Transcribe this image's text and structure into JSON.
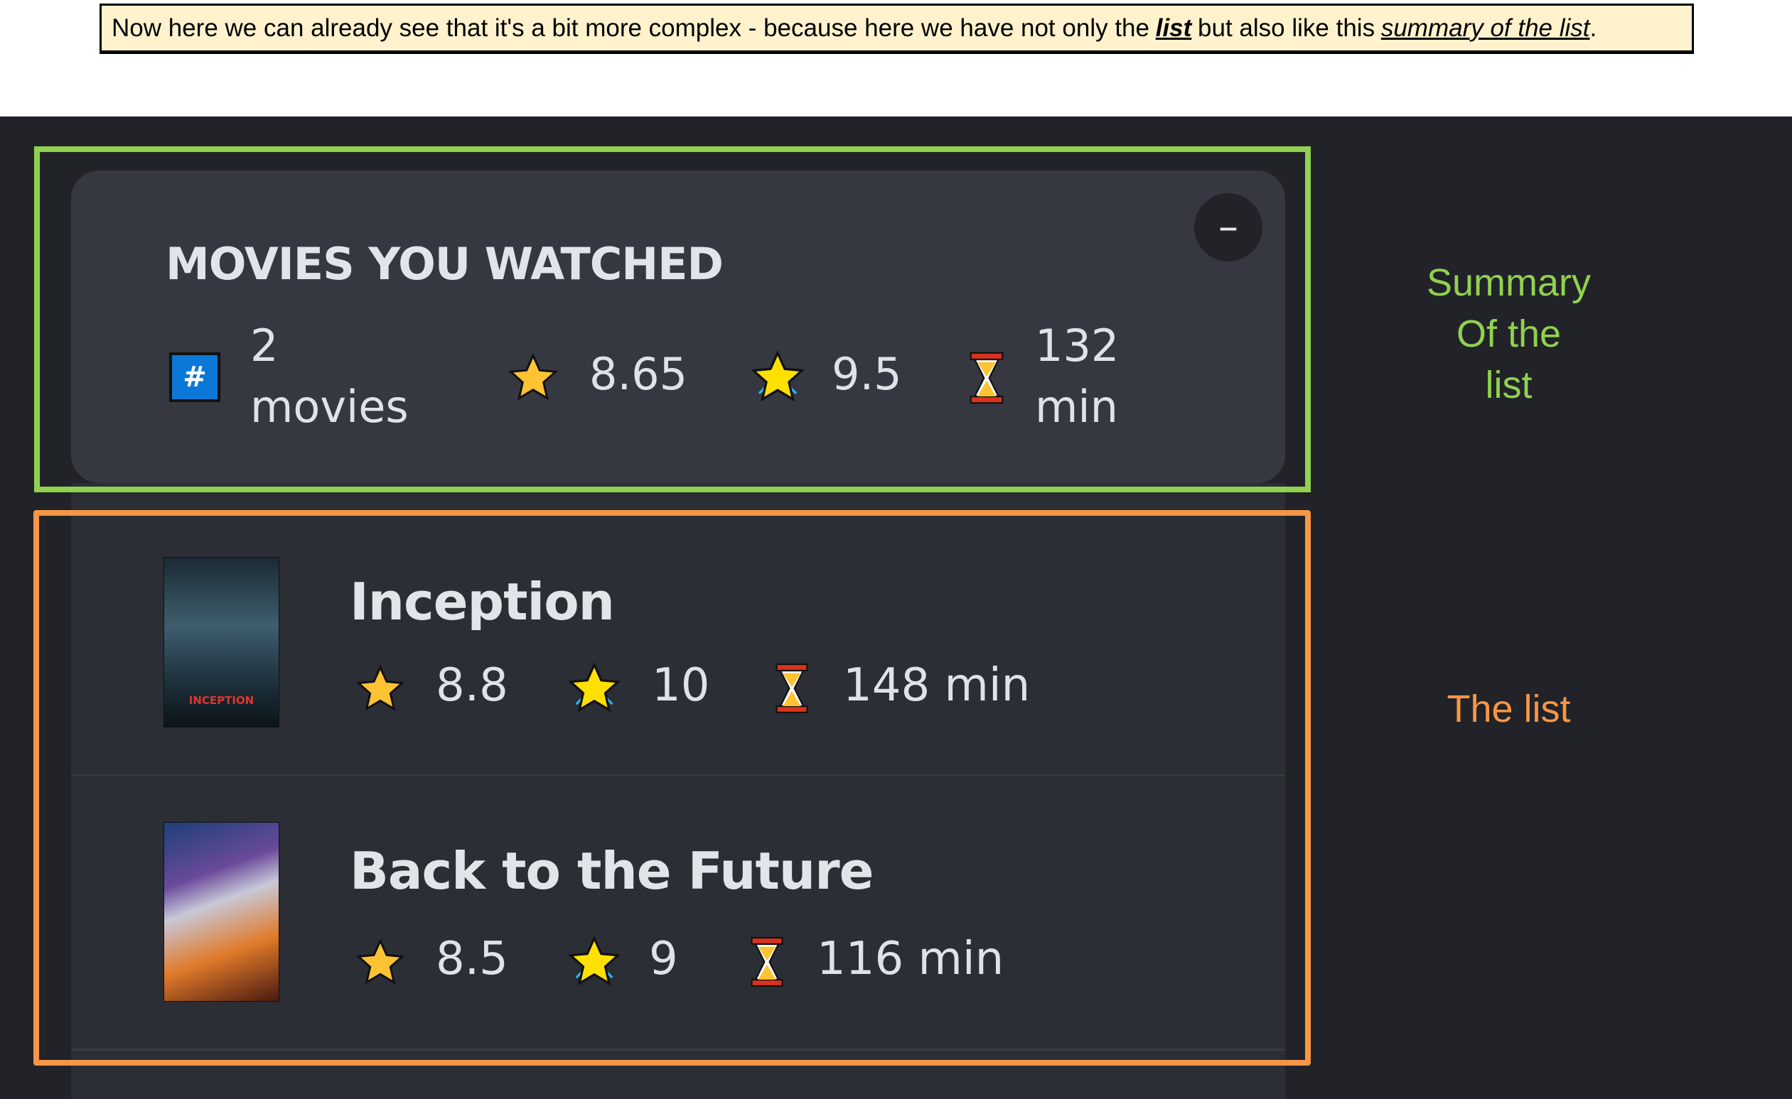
{
  "caption": {
    "before": "Now here we can already see that it's a bit more complex - because here we have not only the",
    "list_word": "list",
    "middle": "but also like this",
    "summary_phrase": "summary of the list",
    "end": "."
  },
  "summary": {
    "title": "MOVIES YOU WATCHED",
    "collapse_label": "–",
    "count_value": "2",
    "count_unit": "movies",
    "count_icon": "#",
    "avg_rating": "8.65",
    "avg_user_rating": "9.5",
    "avg_runtime_value": "132",
    "avg_runtime_unit": "min"
  },
  "movies": [
    {
      "title": "Inception",
      "imdb_rating": "8.8",
      "user_rating": "10",
      "runtime": "148 min",
      "poster_text": "INCEPTION"
    },
    {
      "title": "Back to the Future",
      "imdb_rating": "8.5",
      "user_rating": "9",
      "runtime": "116 min"
    }
  ],
  "annotations": {
    "summary_lines": [
      "Summary",
      "Of the",
      "list"
    ],
    "list_label": "The list",
    "summary_color": "#92d050",
    "list_color": "#f79646"
  }
}
